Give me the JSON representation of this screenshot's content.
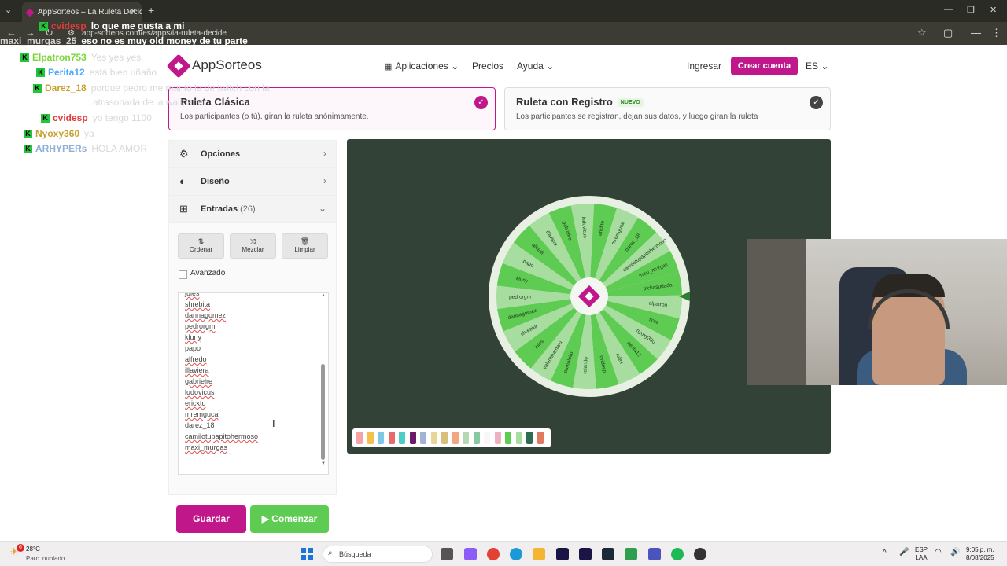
{
  "browser": {
    "tab_title": "AppSorteos – La Ruleta Decide",
    "url": "app-sorteos.com/es/apps/la-ruleta-decide"
  },
  "header": {
    "logo": "AppSorteos",
    "nav": [
      "Aplicaciones",
      "Precios",
      "Ayuda"
    ],
    "login": "Ingresar",
    "signup": "Crear cuenta",
    "lang": "ES"
  },
  "modes": [
    {
      "title": "Ruleta Clásica",
      "desc": "Los participantes (o tú), giran la ruleta anónimamente.",
      "badge": ""
    },
    {
      "title": "Ruleta con Registro",
      "desc": "Los participantes se registran, dejan sus datos, y luego giran la ruleta",
      "badge": "NUEVO"
    }
  ],
  "panel": {
    "options": "Opciones",
    "design": "Diseño",
    "entries": "Entradas",
    "entries_count": "(26)",
    "sort": "Ordenar",
    "shuffle": "Mezclar",
    "clear": "Limpiar",
    "advanced": "Avanzado",
    "entries_list": [
      "jules",
      "shrebita",
      "dannagomez",
      "pedrorgm",
      "kluny",
      "papo",
      "alfredo",
      "illaviera",
      "gabrielre",
      "ludovicus",
      "erickto",
      "mremguca",
      "darez_18",
      "camilotupapitohermoso",
      "maxi_murgas"
    ],
    "save": "Guardar",
    "start": "Comenzar"
  },
  "wheel": {
    "labels": [
      "pichasudada",
      "elpatron",
      "flore",
      "nyoxy360",
      "perita12",
      "rulex",
      "cvidesp",
      "rolando",
      "pumalcito",
      "valentinamaru",
      "jules",
      "shrebita",
      "dannagomez",
      "pedrorgm",
      "kluny",
      "papo",
      "alfredo",
      "illaviera",
      "gabrielre",
      "ludovicus",
      "erickto",
      "mremguca",
      "darez_18",
      "camilotupapitohermoso",
      "maxi_murgas"
    ],
    "color_a": "#5ecb52",
    "color_b": "#a8dda0",
    "center_color": "#c0178a"
  },
  "palette_colors": [
    "#f4a3a8",
    "#f2c14e",
    "#7ec8e3",
    "#e56b6f",
    "#4ecdc4",
    "#6a1b6a",
    "#a0b4d8",
    "#e8d59a",
    "#d8c07a",
    "#f4a582",
    "#b7d7b0",
    "#88c9a1",
    "#f7f7f7",
    "#f0b0c0",
    "#5ecb52",
    "#a8dda0",
    "#2e6b4f",
    "#e07a5f"
  ],
  "chat": [
    {
      "user": "cvidesp",
      "msg": "lo que me gusta a mi",
      "color": "#e23b3b",
      "style": "white"
    },
    {
      "user": "maxi_murgas_25",
      "msg": "eso no es muy old money de tu parte",
      "color": "#d4d4d4",
      "style": "white"
    },
    {
      "user": "Elpatron753",
      "msg": "Yes yes yes",
      "color": "#7ad83a",
      "style": "faint"
    },
    {
      "user": "Perita12",
      "msg": "está bien uñaño",
      "color": "#4fa8ff",
      "style": "faint"
    },
    {
      "user": "Darez_18",
      "msg": "porque pedro me manto la de twitch con la",
      "color": "#c8a030",
      "style": "faint"
    },
    {
      "user": "",
      "msg": "atrasonada de la wallpaper",
      "color": "#c8a030",
      "style": "faint"
    },
    {
      "user": "cvidesp",
      "msg": "yo tengo 1100",
      "color": "#e23b3b",
      "style": "faint"
    },
    {
      "user": "Nyoxy360",
      "msg": "ya",
      "color": "#c8a030",
      "style": "faint"
    },
    {
      "user": "ARHYPERs",
      "msg": "HOLA AMOR",
      "color": "#8fb0d8",
      "style": "faint"
    }
  ],
  "taskbar": {
    "weather_temp": "28°C",
    "weather_desc": "Parc. nublado",
    "weather_badge": "6",
    "search": "Búsqueda",
    "lang_top": "ESP",
    "lang_bottom": "LAA",
    "time": "9:05 p. m.",
    "date": "8/08/2025"
  }
}
